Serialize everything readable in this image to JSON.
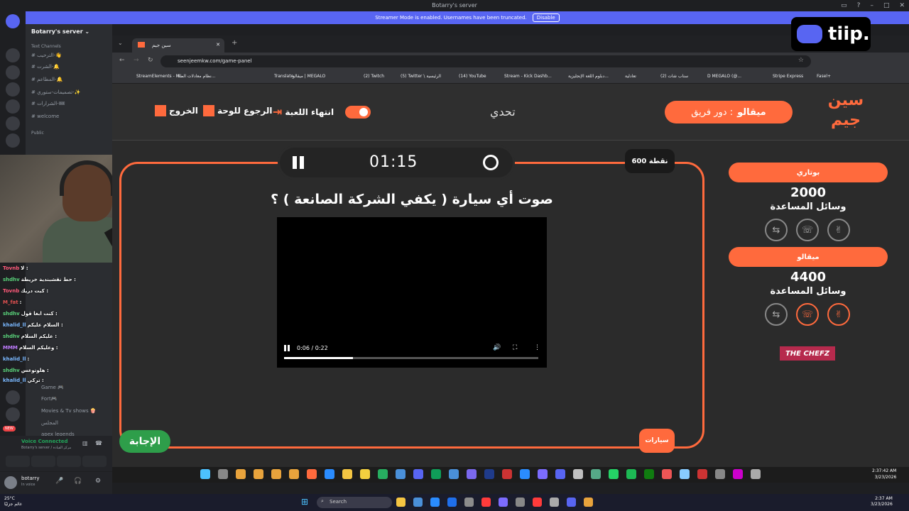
{
  "discord": {
    "window_title": "Botarry's server",
    "banner_text": "Streamer Mode is enabled. Usernames have been truncated.",
    "banner_button": "Disable",
    "server_name": "Botarry's server",
    "text_channels_label": "Text Channels",
    "public_label": "Public",
    "channels": [
      "الترحيب-👋",
      "الشرت-🔔",
      "المطاعم-🔔",
      "تصميمات-ستوري-✨",
      "الشرارات-🎟",
      "welcome"
    ],
    "voice_channels": [
      "Game 🎮",
      "Fort🎮",
      "Movies & Tv shows 🍿",
      "المجلس",
      "apex legends"
    ],
    "new_badge": "NEW",
    "voice_connected": "Voice Connected",
    "voice_sub": "Botarry's server / مركز القيادة",
    "username": "botarry",
    "user_status": "In voice"
  },
  "chat": [
    {
      "user": "Tovnb",
      "color": "#ff5a7a",
      "msg": "لا :"
    },
    {
      "user": "shdhv",
      "color": "#59d17a",
      "msg": "حط نقشبندية خريطة :"
    },
    {
      "user": "Tovnb",
      "color": "#ff5a7a",
      "msg": "كيت دريك :"
    },
    {
      "user": "M_fat",
      "color": "#e05050",
      "msg": ":"
    },
    {
      "user": "shdhv",
      "color": "#59d17a",
      "msg": "كنت ابغا قول :"
    },
    {
      "user": "khalid_ll",
      "color": "#7ab8ff",
      "msg": "السلام عليكم :"
    },
    {
      "user": "shdhv",
      "color": "#59d17a",
      "msg": "عليكم السلام :"
    },
    {
      "user": "MMM",
      "color": "#c07cff",
      "msg": "وعليكم السلام :"
    },
    {
      "user": "khalid_ll",
      "color": "#7ab8ff",
      "msg": ":"
    },
    {
      "user": "shdhv",
      "color": "#59d17a",
      "msg": "هلوتوعس :"
    },
    {
      "user": "khalid_ll",
      "color": "#7ab8ff",
      "msg": "تركي :"
    }
  ],
  "tiip_label": "tiip.",
  "browser": {
    "tab_title": "سين جيم",
    "url": "seenjeemkw.com/game-panel",
    "bookmarks": [
      "StreamElements - M...",
      "نظام معادلات الطلا...",
      "Translate",
      "ميقالو | MEGALO",
      "(2) Twitch",
      "(5) Twitter \\ الرئيسية",
      "(14) YouTube",
      "Stream - Kick Dashb...",
      "دبلوم اللغة الإنجليزية...",
      "تعادلية",
      "(2) سناب شات",
      "D MEGALO (@...",
      "Stripe Express",
      "Fasel+"
    ]
  },
  "game": {
    "exit": "الخروج",
    "back_to_board": "الرجوع للوحة",
    "end_game": "انتهاء اللعبة",
    "challenge": "تحدي",
    "team_turn_prefix": "دور فريق :",
    "team_turn_name": "ميقالو",
    "logo_text_1": "سين",
    "logo_text_2": "جيم",
    "timer": "01:15",
    "points": "600 نقطة",
    "question": "صوت أي سيارة ( يكفي الشركة الصانعة ) ؟",
    "video_time": "0:06 / 0:22",
    "video_progress": 0.27,
    "answer_button": "الإجابة",
    "category": "سيارات",
    "sponsor": "THE CHEFZ",
    "teams": [
      {
        "name": "بوتاري",
        "score": "2000",
        "help_label": "وسائل المساعدة",
        "aids": [
          "⇆",
          "☏",
          "✌"
        ],
        "active": [
          false,
          false,
          false
        ]
      },
      {
        "name": "ميقالو",
        "score": "4400",
        "help_label": "وسائل المساعدة",
        "aids": [
          "⇆",
          "☏",
          "✌"
        ],
        "active": [
          false,
          true,
          true
        ]
      }
    ]
  },
  "inner_clock": {
    "time": "2:37:42 AM",
    "date": "3/23/2026"
  },
  "taskbar": {
    "search_placeholder": "Search",
    "weather_temp": "25°C",
    "weather_desc": "غائم جزئيًا",
    "time": "2:37 AM",
    "date": "3/23/2026"
  },
  "colors": {
    "accent": "#ff6a3d",
    "answer_green": "#2e9e4a",
    "discord_blurple": "#5865f2"
  }
}
